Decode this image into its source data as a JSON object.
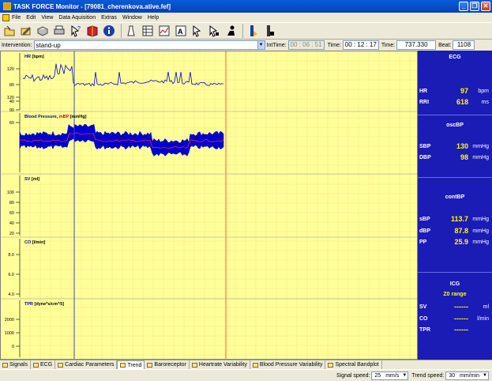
{
  "window": {
    "title": "TASK FORCE Monitor - [79081_cherenkova.ative.fef]",
    "minimize": "_",
    "restore": "❐",
    "close": "✕"
  },
  "menu": [
    "File",
    "Edit",
    "View",
    "Data Aquisition",
    "Extras",
    "Window",
    "Help"
  ],
  "toolbar_icons": [
    "open-icon",
    "edit-icon",
    "save-icon",
    "print-icon",
    "help-pointer-icon",
    "book-icon",
    "info-icon",
    "marker-icon",
    "table-icon",
    "chart-icon",
    "text-icon",
    "cursor-icon",
    "cursor2-icon",
    "person-icon",
    "bar-icon",
    "stop-icon"
  ],
  "intervention": {
    "label": "Intervention:",
    "value": "stand-up",
    "inttime_label": "IntTime:",
    "inttime": "00 : 06 : 51",
    "time_label": "Time:",
    "time": "00 : 12 : 17",
    "time2_label": "Time:",
    "time2": "737.330",
    "beat_label": "Beat:",
    "beat": "1108"
  },
  "chart_data": {
    "type": "line",
    "panels": [
      {
        "label": "HR",
        "unit": "[bpm]",
        "ticks": [
          "120",
          "80",
          "40"
        ]
      },
      {
        "label": "Blood Pressure,",
        "label_extra": "mBP",
        "unit": "[mmHg]",
        "ticks": [
          "120",
          "90",
          "60"
        ]
      },
      {
        "label": "SV",
        "unit": "[ml]",
        "ticks": [
          "100",
          "80",
          "60",
          "40",
          "20"
        ]
      },
      {
        "label": "CO",
        "unit": "[l/min]",
        "ticks": [
          "8.0",
          "6.0",
          "4.0"
        ]
      },
      {
        "label": "TPR",
        "unit": "[dyne*s/cm^5]",
        "ticks": [
          "2000",
          "1000",
          "0"
        ]
      }
    ]
  },
  "panel": {
    "ecg": {
      "title": "ECG",
      "rows": [
        {
          "label": "HR",
          "value": "97",
          "unit": "bpm"
        },
        {
          "label": "RRI",
          "value": "618",
          "unit": "ms"
        }
      ]
    },
    "oscbp": {
      "title": "oscBP",
      "rows": [
        {
          "label": "SBP",
          "value": "130",
          "unit": "mmHg"
        },
        {
          "label": "DBP",
          "value": "98",
          "unit": "mmHg"
        }
      ]
    },
    "contbp": {
      "title": "contBP",
      "rows": [
        {
          "label": "sBP",
          "value": "113.7",
          "unit": "mmHg"
        },
        {
          "label": "dBP",
          "value": "87.8",
          "unit": "mmHg"
        },
        {
          "label": "PP",
          "value": "25.9",
          "unit": "mmHg"
        }
      ]
    },
    "icg": {
      "title": "ICG",
      "subtitle": "Z0 range",
      "rows": [
        {
          "label": "SV",
          "value": "------",
          "unit": "ml"
        },
        {
          "label": "CO",
          "value": "------",
          "unit": "l/min"
        },
        {
          "label": "TPR",
          "value": "------",
          "unit": ""
        }
      ]
    }
  },
  "tabs": [
    "Signals",
    "ECG",
    "Cardiac Parameters",
    "Trend",
    "Baroreceptor",
    "Heartrate Variability",
    "Blood Pressure Variability",
    "Spectral Bandplot"
  ],
  "active_tab": "Trend",
  "status": {
    "signal_speed_label": "Signal speed:",
    "signal_speed": "25",
    "signal_speed_unit": "mm/s",
    "trend_speed_label": "Trend speed:",
    "trend_speed": "30",
    "trend_speed_unit": "mm/min"
  },
  "colors": {
    "plot_bg": "#ffff9a",
    "grid": "#e8c870",
    "trace": "#0000cc",
    "mbp": "#ff3333",
    "panel_bg": "#1b1bb5",
    "value": "#ffff00",
    "cursor_red": "#ff6a3a",
    "cursor_blue": "#3b4ea8"
  }
}
